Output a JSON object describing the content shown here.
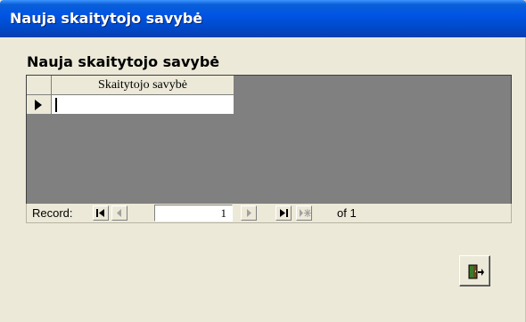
{
  "window": {
    "title": "Nauja skaitytojo savybė"
  },
  "form": {
    "subform_label": "Nauja skaitytojo savybė"
  },
  "datasheet": {
    "columns": [
      "Skaitytojo savybė"
    ],
    "rows": [
      {
        "value": ""
      }
    ]
  },
  "navigation": {
    "record_label": "Record:",
    "current_record": "1",
    "of_label": "of 1",
    "buttons": [
      "first-record",
      "previous-record",
      "next-record",
      "last-record",
      "new-record"
    ]
  },
  "actions": {
    "exit_button_icon": "exit-door-icon"
  },
  "colors": {
    "titlebar": "#0055e5",
    "window_bg": "#ece9d8",
    "datasheet_bg": "#808080"
  }
}
